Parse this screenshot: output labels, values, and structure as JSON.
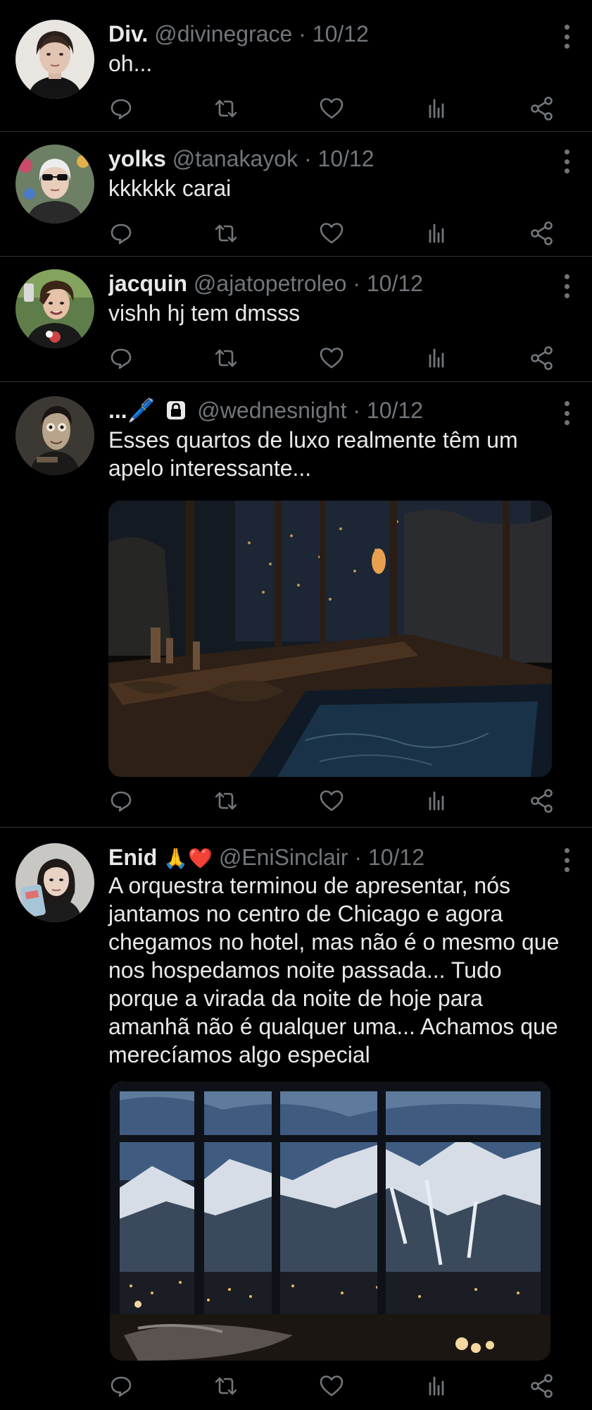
{
  "tweets": [
    {
      "name": "Div.",
      "handle": "@divinegrace",
      "sep": "·",
      "date": "10/12",
      "text": "oh...",
      "has_media": false
    },
    {
      "name": "yolks",
      "handle": "@tanakayok",
      "sep": "·",
      "date": "10/12",
      "text": "kkkkkk carai",
      "has_media": false
    },
    {
      "name": "jacquin",
      "handle": "@ajatopetroleo",
      "sep": "·",
      "date": "10/12",
      "text": "vishh hj tem dmsss",
      "has_media": false
    },
    {
      "name": "...🖊️",
      "handle": "@wednesnight",
      "sep": "·",
      "date": "10/12",
      "text": "Esses quartos de luxo realmente têm um apelo interessante...",
      "has_media": true,
      "media_subject": "luxury bathroom with stone bathtub and night city view"
    },
    {
      "name": "Enid",
      "name_emoji": "🙏❤️",
      "handle": "@EniSinclair",
      "sep": "·",
      "date": "10/12",
      "text": "A orquestra terminou de apresentar, nós jantamos no centro de Chicago e agora chegamos no hotel, mas não é o mesmo que nos hospedamos noite passada... Tudo porque a virada da noite de hoje para amanhã não é qualquer uma... Achamos que merecíamos algo especial",
      "has_media": true,
      "media_subject": "hotel room with large windows overlooking snowy mountains at night"
    }
  ],
  "icons": {
    "reply": "reply-icon",
    "retweet": "retweet-icon",
    "like": "heart-icon",
    "views": "views-icon",
    "share": "share-icon",
    "more": "more-icon",
    "lock": "lock-icon"
  },
  "colors": {
    "background": "#000000",
    "text": "#e7e9ea",
    "secondary": "#71767b",
    "divider": "#2f3336"
  }
}
